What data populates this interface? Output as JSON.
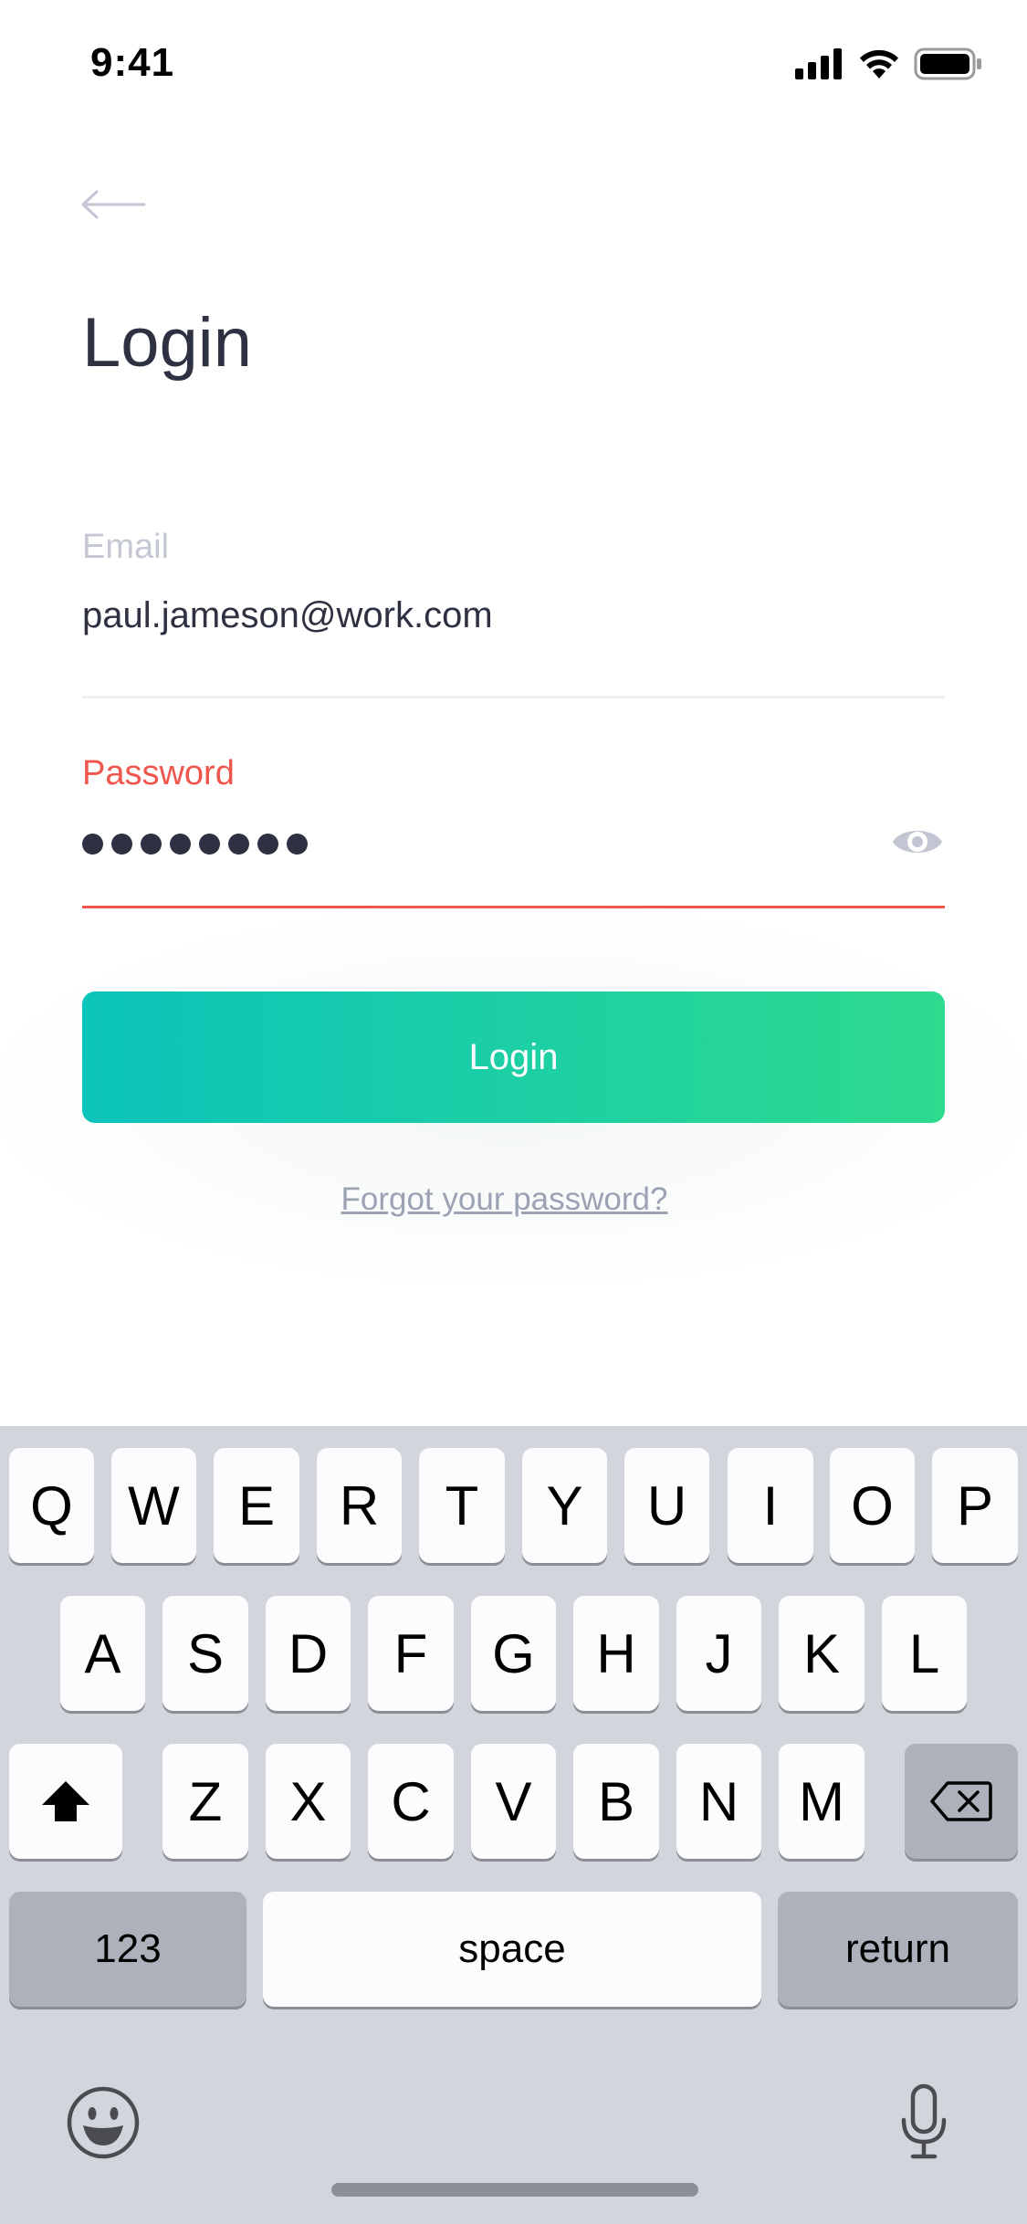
{
  "status_bar": {
    "time": "9:41"
  },
  "page": {
    "title": "Login"
  },
  "email": {
    "label": "Email",
    "value": "paul.jameson@work.com"
  },
  "password": {
    "label": "Password",
    "masked_length": 8
  },
  "login_button": {
    "label": "Login"
  },
  "forgot_link": {
    "label": "Forgot your password?"
  },
  "colors": {
    "title": "#2e3141",
    "error": "#f0564d",
    "gradient_start": "#0bc4bb",
    "gradient_end": "#2dda8e",
    "link": "#9ba2b4"
  },
  "keyboard": {
    "row1": [
      "Q",
      "W",
      "E",
      "R",
      "T",
      "Y",
      "U",
      "I",
      "O",
      "P"
    ],
    "row2": [
      "A",
      "S",
      "D",
      "F",
      "G",
      "H",
      "J",
      "K",
      "L"
    ],
    "row3": [
      "Z",
      "X",
      "C",
      "V",
      "B",
      "N",
      "M"
    ],
    "numbers_key": "123",
    "space_key": "space",
    "return_key": "return",
    "icons": [
      "shift-icon",
      "backspace-icon",
      "emoji-icon",
      "microphone-icon"
    ]
  }
}
